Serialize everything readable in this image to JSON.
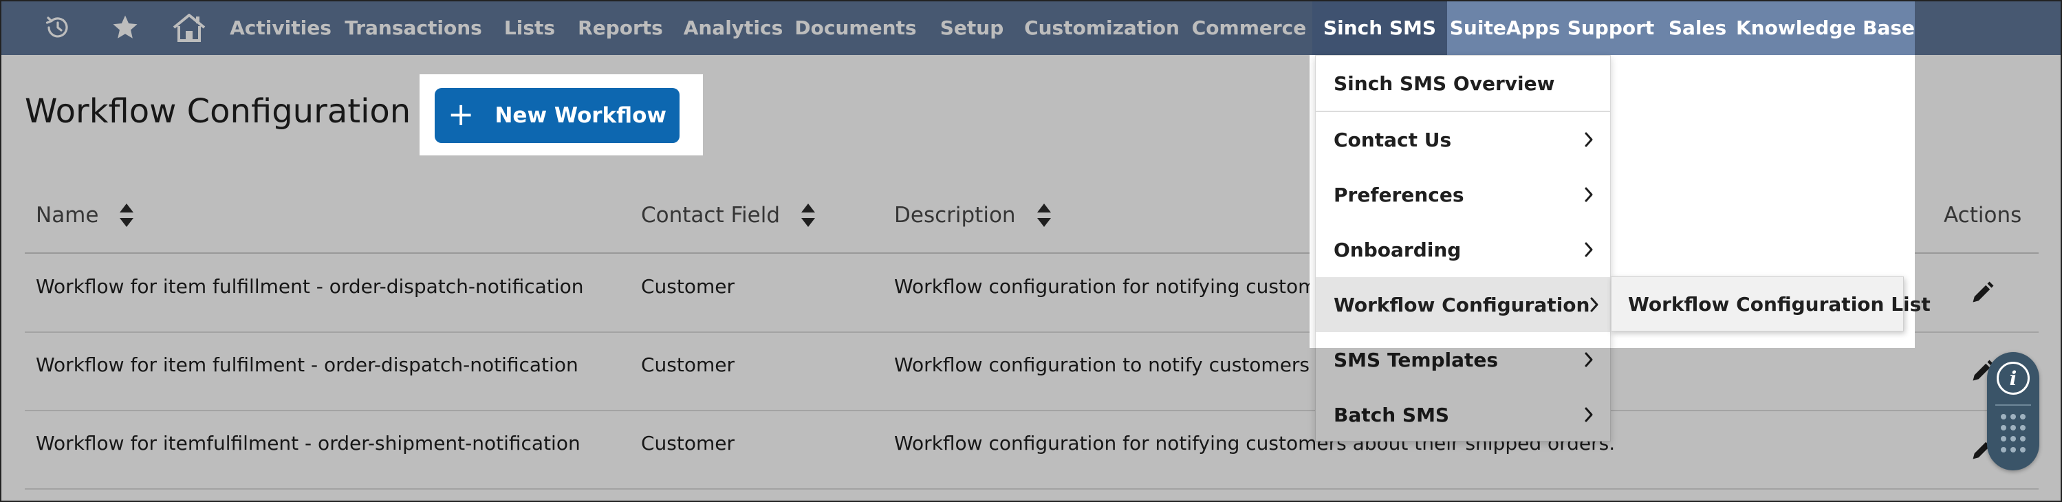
{
  "nav": {
    "items": [
      "Activities",
      "Transactions",
      "Lists",
      "Reports",
      "Analytics",
      "Documents",
      "Setup",
      "Customization",
      "Commerce",
      "Sinch SMS",
      "SuiteApps",
      "Support",
      "Sales",
      "Knowledge Base"
    ],
    "active": "Sinch SMS",
    "icons": [
      "recent-records-icon",
      "star-icon",
      "home-icon"
    ]
  },
  "page": {
    "title": "Workflow Configuration",
    "new_button": "New Workflow",
    "new_button_icon": "plus-icon"
  },
  "table": {
    "columns": [
      "Name",
      "Contact Field",
      "Description",
      "Actions"
    ],
    "rows": [
      {
        "name": "Workflow for item fulfillment - order-dispatch-notification",
        "contact_field": "Customer",
        "description": "Workflow configuration for notifying customers"
      },
      {
        "name": "Workflow for item fulfilment - order-dispatch-notification",
        "contact_field": "Customer",
        "description": "Workflow configuration to notify customers abo"
      },
      {
        "name": "Workflow for itemfulfilment - order-shipment-notification",
        "contact_field": "Customer",
        "description": "Workflow configuration for notifying customers about their shipped orders."
      }
    ]
  },
  "dropdown": {
    "items": [
      {
        "label": "Sinch SMS Overview",
        "has_submenu": false
      },
      {
        "label": "Contact Us",
        "has_submenu": true
      },
      {
        "label": "Preferences",
        "has_submenu": true
      },
      {
        "label": "Onboarding",
        "has_submenu": true
      },
      {
        "label": "Workflow Configuration",
        "has_submenu": true
      },
      {
        "label": "SMS Templates",
        "has_submenu": true
      },
      {
        "label": "Batch SMS",
        "has_submenu": true
      }
    ],
    "hovered": "Workflow Configuration",
    "submenu": [
      "Workflow Configuration List"
    ]
  },
  "colors": {
    "nav_bg": "#607799",
    "nav_active": "#3f5270",
    "primary_button": "#0d67b0",
    "help_widget": "#3a5468"
  }
}
